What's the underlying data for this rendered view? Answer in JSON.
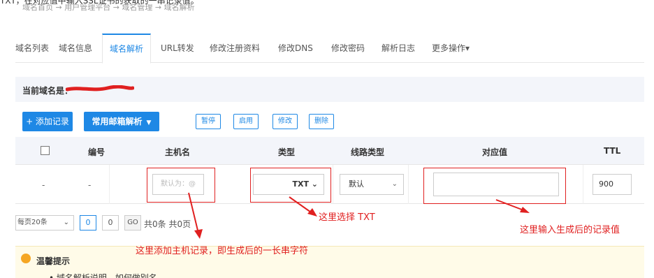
{
  "top_instruction": "TXT，在对应值中输入SSL证书的获取的一串记录值。",
  "breadcrumb": "域名首页 → 用户管理平台 → 域名管理 → 域名解析",
  "tabs": [
    {
      "label": "域名列表"
    },
    {
      "label": "域名信息"
    },
    {
      "label": "域名解析"
    },
    {
      "label": "URL转发"
    },
    {
      "label": "修改注册资料"
    },
    {
      "label": "修改DNS"
    },
    {
      "label": "修改密码"
    },
    {
      "label": "解析日志"
    },
    {
      "label": "更多操作▾"
    }
  ],
  "domain_bar": {
    "label": "当前域名是："
  },
  "actions": {
    "add": "+ 添加记录",
    "mail": "常用邮箱解析",
    "mail_caret": "▼",
    "pause": "暂停",
    "enable": "启用",
    "edit": "修改",
    "delete": "删除"
  },
  "table": {
    "headers": {
      "id": "编号",
      "host": "主机名",
      "type": "类型",
      "line": "线路类型",
      "value": "对应值",
      "ttl": "TTL"
    },
    "row": {
      "dash1": "-",
      "dash2": "-",
      "host_placeholder": "默认为：@",
      "type": "TXT ⌄",
      "line": "默认",
      "value": "",
      "ttl": "900"
    }
  },
  "pager": {
    "per_page": "每页20条",
    "current": "0",
    "total": "0",
    "go": "GO",
    "summary": "共0条 共0页"
  },
  "tips": {
    "title": "温馨提示",
    "line": "• 域名解析说明，如何做别名"
  },
  "annotations": {
    "select_txt": "这里选择 TXT",
    "enter_value": "这里输入生成后的记录值",
    "add_host": "这里添加主机记录，即生成后的一长串字符"
  },
  "colors": {
    "accent": "#1e88e5",
    "annotation": "#e02020",
    "header_bg": "#f3f5fa",
    "tips_bg": "#fffbe8"
  }
}
